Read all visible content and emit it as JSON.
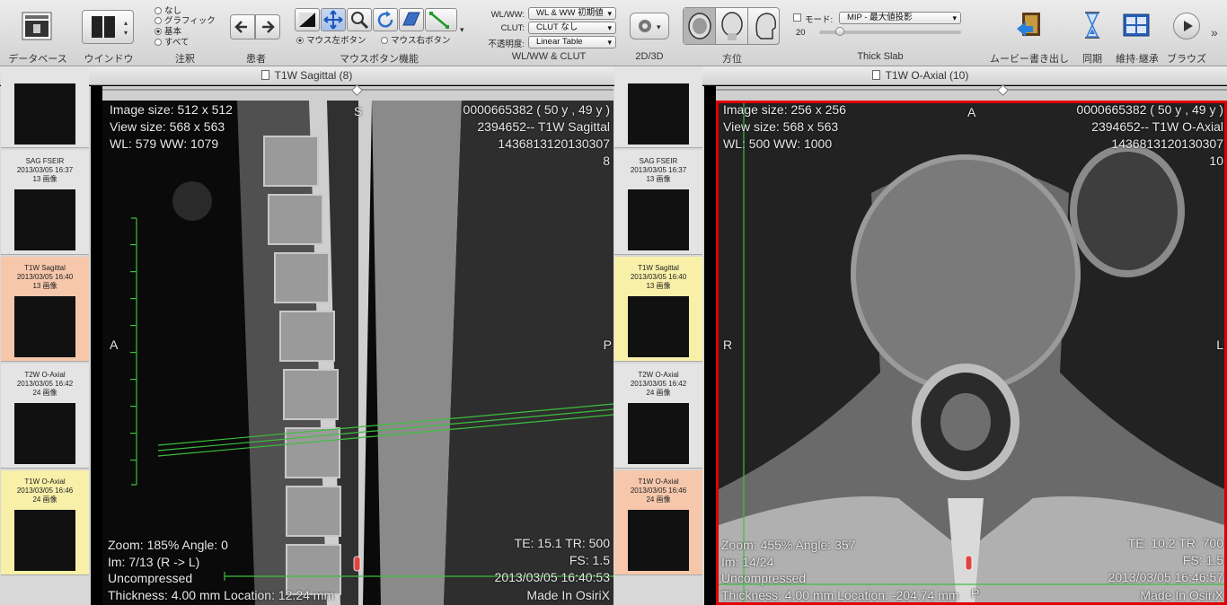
{
  "toolbar": {
    "labels": {
      "database": "データベース",
      "window": "ウインドウ",
      "annotation": "注釈",
      "patient": "患者",
      "mouse_function": "マウスボタン機能",
      "wlww_clut": "WL/WW & CLUT",
      "view_2d3d": "2D/3D",
      "orientation": "方位",
      "thick_slab": "Thick Slab",
      "movie_export": "ムービー書き出し",
      "sync": "同期",
      "keep": "維持·継承",
      "browse": "ブラウズ"
    },
    "annotation_options": [
      "なし",
      "グラフィック",
      "基本",
      "すべて"
    ],
    "annotation_selected": "基本",
    "mouse_left": "マウス左ボタン",
    "mouse_right": "マウス右ボタン",
    "wlww_label": "WL/WW:",
    "wlww_value": "WL & WW 初期値",
    "clut_label": "CLUT:",
    "clut_value": "CLUT なし",
    "opacity_label": "不透明度:",
    "opacity_value": "Linear Table",
    "mode_label": "モード:",
    "mode_value": "MIP - 最大値投影",
    "slab_value": "20"
  },
  "left_window": {
    "title": "T1W Sagittal (8)",
    "thumbs": [
      {
        "name": "",
        "date": "",
        "count": ""
      },
      {
        "name": "SAG FSEIR",
        "date": "2013/03/05 16:37",
        "count": "13 画像"
      },
      {
        "name": "T1W Sagittal",
        "date": "2013/03/05 16:40",
        "count": "13 画像"
      },
      {
        "name": "T2W O-Axial",
        "date": "2013/03/05 16:42",
        "count": "24 画像"
      },
      {
        "name": "T1W O-Axial",
        "date": "2013/03/05 16:46",
        "count": "24 画像"
      }
    ],
    "overlay": {
      "image_size": "Image size: 512 x 512",
      "view_size": "View size: 568 x 563",
      "wlww": "WL: 579 WW: 1079",
      "patient_id": "0000665382 (  50 y ,  49 y )",
      "series": "2394652-- T1W Sagittal",
      "study_id": "1436813120130307",
      "image_no": "8",
      "top_marker": "S",
      "left_marker": "A",
      "right_marker": "P",
      "zoom": "Zoom: 185%  Angle: 0",
      "im": "Im: 7/13  (R -> L)",
      "compression": "Uncompressed",
      "thickness": "Thickness: 4.00 mm Location: 12.24 mm",
      "te_tr": "TE:  15.1 TR:  500",
      "fs": "FS:  1.5",
      "datetime": "2013/03/05 16:40:53",
      "made_in": "Made In OsiriX"
    }
  },
  "right_window": {
    "title": "T1W O-Axial (10)",
    "thumbs": [
      {
        "name": "",
        "date": "",
        "count": ""
      },
      {
        "name": "SAG FSEIR",
        "date": "2013/03/05 16:37",
        "count": "13 画像"
      },
      {
        "name": "T1W Sagittal",
        "date": "2013/03/05 16:40",
        "count": "13 画像"
      },
      {
        "name": "T2W O-Axial",
        "date": "2013/03/05 16:42",
        "count": "24 画像"
      },
      {
        "name": "T1W O-Axial",
        "date": "2013/03/05 16:46",
        "count": "24 画像"
      }
    ],
    "overlay": {
      "image_size": "Image size: 256 x 256",
      "view_size": "View size: 568 x 563",
      "wlww": "WL: 500 WW: 1000",
      "patient_id": "0000665382 (  50 y ,  49 y )",
      "series": "2394652-- T1W O-Axial",
      "study_id": "1436813120130307",
      "image_no": "10",
      "top_marker": "A",
      "left_marker": "R",
      "right_marker": "L",
      "bottom_marker": "P",
      "zoom": "Zoom: 455%  Angle: 357",
      "im": "Im: 14/24",
      "compression": "Uncompressed",
      "thickness": "Thickness: 4.00 mm Location: -204.74 mm",
      "te_tr": "TE:  10.2 TR:  700",
      "fs": "FS:  1.5",
      "datetime": "2013/03/05 16:46:57",
      "made_in": "Made In OsiriX"
    }
  },
  "colors": {
    "active_border": "#e00000",
    "thumb_selected": "#f6c7ab",
    "thumb_highlight": "#f8f0a8",
    "measure_green": "#3cc03c"
  }
}
